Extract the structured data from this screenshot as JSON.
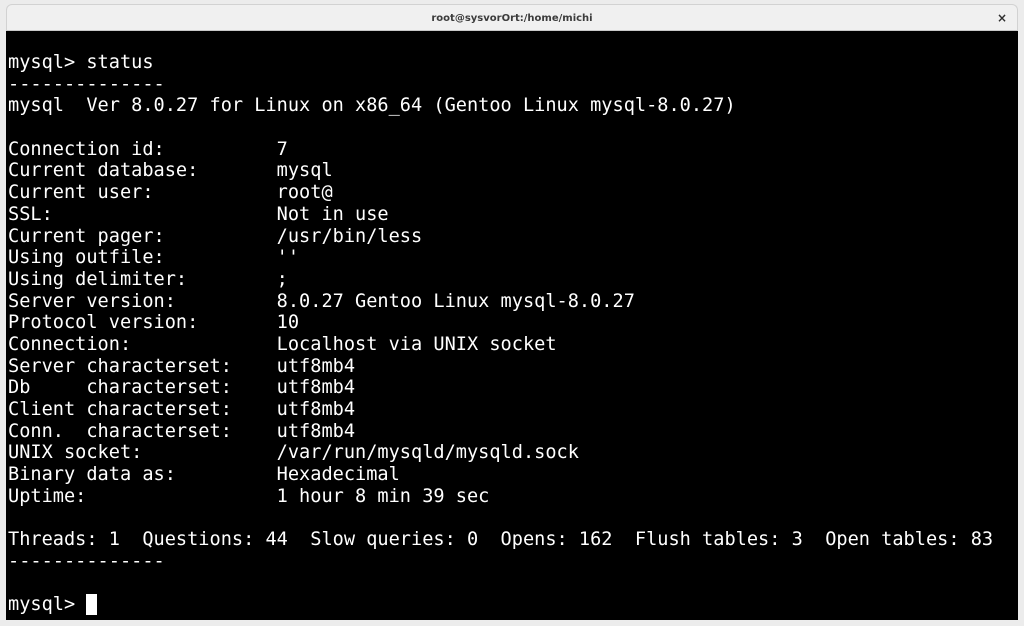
{
  "window": {
    "title": "root@sysvorOrt:/home/michi",
    "close_glyph": "×"
  },
  "terminal": {
    "lines": [
      "mysql> status",
      "--------------",
      "mysql  Ver 8.0.27 for Linux on x86_64 (Gentoo Linux mysql-8.0.27)",
      "",
      "Connection id:          7",
      "Current database:       mysql",
      "Current user:           root@",
      "SSL:                    Not in use",
      "Current pager:          /usr/bin/less",
      "Using outfile:          ''",
      "Using delimiter:        ;",
      "Server version:         8.0.27 Gentoo Linux mysql-8.0.27",
      "Protocol version:       10",
      "Connection:             Localhost via UNIX socket",
      "Server characterset:    utf8mb4",
      "Db     characterset:    utf8mb4",
      "Client characterset:    utf8mb4",
      "Conn.  characterset:    utf8mb4",
      "UNIX socket:            /var/run/mysqld/mysqld.sock",
      "Binary data as:         Hexadecimal",
      "Uptime:                 1 hour 8 min 39 sec",
      "",
      "Threads: 1  Questions: 44  Slow queries: 0  Opens: 162  Flush tables: 3  Open tables: 83",
      "--------------",
      ""
    ],
    "prompt": "mysql> ",
    "colors": {
      "background": "#000000",
      "foreground": "#ffffff"
    }
  }
}
